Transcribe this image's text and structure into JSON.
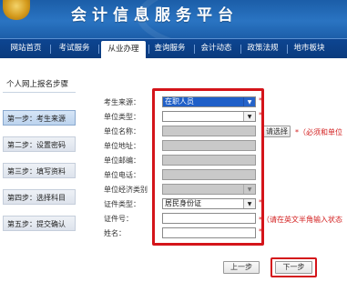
{
  "header": {
    "title": "会计信息服务平台",
    "emblem": "national-emblem"
  },
  "nav": {
    "items": [
      {
        "label": "网站首页"
      },
      {
        "label": "考试服务"
      },
      {
        "label": "从业办理",
        "active": true
      },
      {
        "label": "查询服务"
      },
      {
        "label": "会计动态"
      },
      {
        "label": "政策法规"
      },
      {
        "label": "地市板块"
      }
    ]
  },
  "sidebar": {
    "title": "个人网上报名步骤",
    "steps": [
      {
        "label": "第一步：考生来源",
        "active": true
      },
      {
        "label": "第二步：设置密码"
      },
      {
        "label": "第三步：填写资料"
      },
      {
        "label": "第四步：选择科目"
      },
      {
        "label": "第五步：提交确认"
      }
    ]
  },
  "form": {
    "source_label": "考生来源：",
    "source_value": "在职人员",
    "unit_type_label": "单位类型：",
    "unit_name_label": "单位名称：",
    "unit_address_label": "单位地址：",
    "unit_postcode_label": "单位邮编：",
    "unit_phone_label": "单位电话：",
    "unit_econ_label": "单位经济类别",
    "id_type_label": "证件类型：",
    "id_type_value": "居民身份证",
    "id_number_label": "证件号：",
    "name_label": "姓名：",
    "choose_button": "请选择",
    "unit_required_note": "*（必须和单位",
    "id_note": "*（请在英文半角输入状态",
    "required_mark": "*"
  },
  "buttons": {
    "prev": "上一步",
    "next": "下一步"
  },
  "colors": {
    "header_blue": "#1b5da8",
    "nav_blue": "#0d4591",
    "highlight_red": "#d4141a",
    "required_red": "#d32020"
  }
}
